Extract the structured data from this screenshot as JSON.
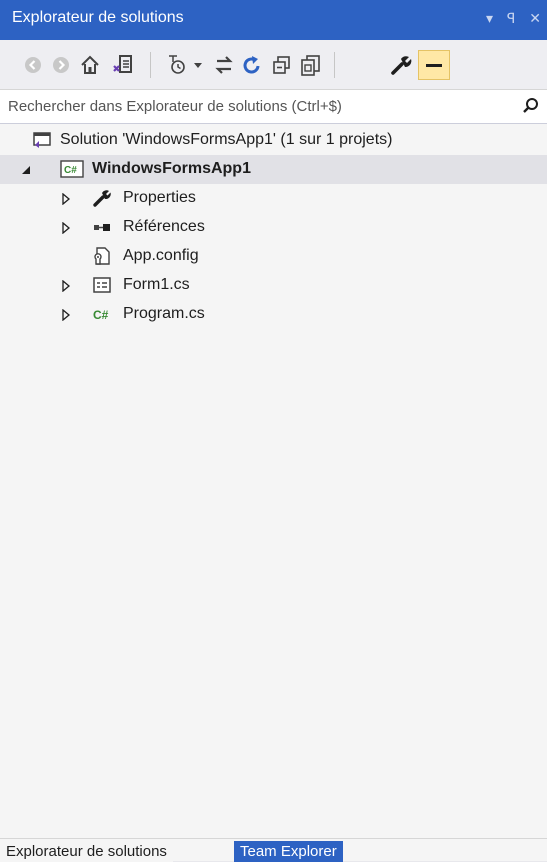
{
  "window": {
    "title": "Explorateur de solutions",
    "dropdown_glyph": "▾",
    "pin_glyph": "ꟼ",
    "close_glyph": "✕"
  },
  "toolbar": {
    "buttons": [
      "back-icon",
      "forward-icon",
      "home-icon",
      "switch-views-icon",
      "pending-changes-filter-icon",
      "sync-active-document-icon",
      "refresh-icon",
      "collapse-all-icon",
      "show-all-files-icon",
      "properties-icon",
      "preview-selected-icon"
    ]
  },
  "search": {
    "placeholder": "Rechercher dans Explorateur de solutions (Ctrl+$)"
  },
  "tree": {
    "solution": "Solution 'WindowsFormsApp1' (1 sur 1 projets)",
    "project": "WindowsFormsApp1",
    "project_badge": "C#",
    "items": [
      {
        "label": "Properties",
        "icon": "wrench-icon",
        "expandable": true
      },
      {
        "label": "Références",
        "icon": "references-icon",
        "expandable": true
      },
      {
        "label": "App.config",
        "icon": "config-file-icon",
        "expandable": false
      },
      {
        "label": "Form1.cs",
        "icon": "form-icon",
        "expandable": true
      },
      {
        "label": "Program.cs",
        "icon": "csharp-file-icon",
        "expandable": true
      }
    ]
  },
  "tabs": {
    "active": "Explorateur de solutions",
    "inactive": "Team Explorer"
  },
  "colors": {
    "accent": "#2d62c3",
    "selected_row": "#e1e1e6",
    "highlight_button": "#ffe8a6"
  }
}
